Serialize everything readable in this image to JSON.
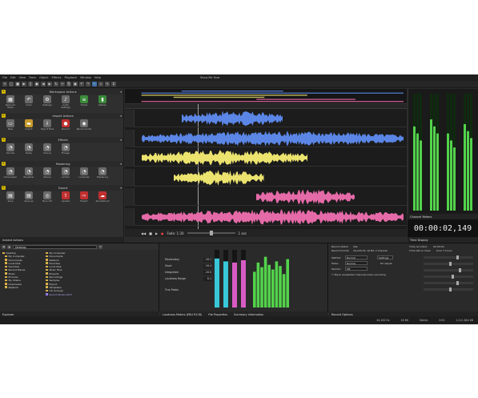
{
  "menubar": {
    "items": [
      "File",
      "Edit",
      "View",
      "Track",
      "Object",
      "Effects",
      "Playback",
      "Window",
      "Help"
    ],
    "help_label": "Show Me How"
  },
  "colors": {
    "accent_yellow": "#d4b800",
    "track_blue": "#5b86e6",
    "track_yellow": "#ece36f",
    "track_pink": "#e56aa8",
    "meter_green": "#53d34b",
    "meter_cyan": "#38c8d8",
    "meter_magenta": "#d85cc4"
  },
  "left_panel": {
    "sections": [
      {
        "num": "1",
        "title": "Workspace Actions",
        "buttons": [
          {
            "label": "Reduced Mode",
            "icon": "layout-icon",
            "color": "#6a6a6a"
          },
          {
            "label": "Undo",
            "icon": "undo-icon",
            "color": "#6a6a6a"
          },
          {
            "label": "Settings",
            "icon": "gear-icon",
            "color": "#6a6a6a"
          },
          {
            "label": "Audio Settings",
            "icon": "speaker-icon",
            "color": "#6a6a6a"
          },
          {
            "label": "Tracks",
            "icon": "tracks-icon",
            "color": "#3a8a3a"
          },
          {
            "label": "Marker",
            "icon": "marker-icon",
            "color": "#3a8a3a"
          }
        ]
      },
      {
        "num": "2",
        "title": "Import Actions",
        "buttons": [
          {
            "label": "New",
            "icon": "new-file-icon",
            "color": "#6a6a6a"
          },
          {
            "label": "Import",
            "icon": "folder-icon",
            "color": "#c99a2a"
          },
          {
            "label": "Import Files",
            "icon": "import-icon",
            "color": "#6a6a6a"
          },
          {
            "label": "Record",
            "icon": "record-icon",
            "color": "#c03030"
          },
          {
            "label": "Record Audio",
            "icon": "mic-icon",
            "color": "#6a6a6a"
          }
        ]
      },
      {
        "num": "3",
        "title": "Effects",
        "buttons": [
          {
            "label": "Volume",
            "icon": "dial-icon",
            "color": "#6a6a6a"
          },
          {
            "label": "Delay",
            "icon": "dial-icon",
            "color": "#6a6a6a"
          },
          {
            "label": "Chorus",
            "icon": "dial-icon",
            "color": "#6a6a6a"
          },
          {
            "label": "Flanger",
            "icon": "dial-icon",
            "color": "#6a6a6a"
          }
        ]
      },
      {
        "num": "4",
        "title": "Mastering",
        "buttons": [
          {
            "label": "Compressor",
            "icon": "dial-icon",
            "color": "#6a6a6a"
          },
          {
            "label": "Equalizer",
            "icon": "dial-icon",
            "color": "#6a6a6a"
          },
          {
            "label": "Stereo",
            "icon": "dial-icon",
            "color": "#6a6a6a"
          },
          {
            "label": "Limiter",
            "icon": "dial-icon",
            "color": "#6a6a6a"
          },
          {
            "label": "Loudness",
            "icon": "dial-icon",
            "color": "#6a6a6a"
          },
          {
            "label": "Mastering",
            "icon": "dial-icon",
            "color": "#6a6a6a"
          }
        ]
      },
      {
        "num": "5",
        "title": "Export",
        "buttons": [
          {
            "label": "Save",
            "icon": "save-icon",
            "color": "#6a6a6a"
          },
          {
            "label": "Save as",
            "icon": "save-as-icon",
            "color": "#6a6a6a"
          },
          {
            "label": "Burn CD",
            "icon": "cd-icon",
            "color": "#6a6a6a"
          },
          {
            "label": "Upload",
            "icon": "upload-icon",
            "color": "#c03030"
          },
          {
            "label": "Export",
            "icon": "export-icon",
            "color": "#c03030"
          },
          {
            "label": "SoundCloud",
            "icon": "cloud-icon",
            "color": "#c03030"
          }
        ]
      }
    ],
    "footer": "Instant Actions"
  },
  "tracks": {
    "lanes": [
      {
        "color": "#5b86e6",
        "start": 0.17,
        "end": 0.55
      },
      {
        "color": "#5b86e6",
        "start": 0.02,
        "end": 1.0
      },
      {
        "color": "#ece36f",
        "start": 0.02,
        "end": 0.64
      },
      {
        "color": "#ece36f",
        "start": 0.14,
        "end": 0.48
      },
      {
        "color": "#e56aa8",
        "start": 0.45,
        "end": 0.82
      },
      {
        "color": "#e56aa8",
        "start": 0.02,
        "end": 1.0
      }
    ],
    "playhead": 0.23,
    "transport_zoom": "Fade: 1:30",
    "transport_label": "1 sec"
  },
  "right_panel": {
    "channel_label": "Channel Meters",
    "time_value": "00:00:02,149",
    "time_label": "Time Display"
  },
  "explorer": {
    "path": "Desktop",
    "tree": [
      "Desktop",
      "My Computer",
      "Documents",
      "Local Disk",
      "Favorites",
      "Recent Places",
      "Music",
      "Pictures",
      "My Videos",
      "Downloads",
      "Network"
    ],
    "files": [
      {
        "name": "My Computer",
        "selected": false
      },
      {
        "name": "Documents",
        "selected": false
      },
      {
        "name": "Network",
        "selected": false
      },
      {
        "name": "Favorites",
        "selected": false
      },
      {
        "name": "Local Disk",
        "selected": false
      },
      {
        "name": "Music Files",
        "selected": false
      },
      {
        "name": "Projects",
        "selected": false
      },
      {
        "name": "Recordings",
        "selected": false
      },
      {
        "name": "Samples",
        "selected": false
      },
      {
        "name": "Export",
        "selected": false
      },
      {
        "name": "Templates",
        "selected": false
      },
      {
        "name": "CD Arrange",
        "selected": false
      },
      {
        "name": "Sound Studio 2017",
        "selected": true
      }
    ],
    "footer": "Explorer"
  },
  "loudness": {
    "rows": [
      {
        "label": "Momentary",
        "value": "-18.1"
      },
      {
        "label": "Short",
        "value": "-16.4"
      },
      {
        "label": "Integrated",
        "value": "-16.0"
      },
      {
        "label": "Loudness Range",
        "value": "6.1"
      }
    ],
    "true_peaks_label": "True Peaks",
    "tabs": [
      "Loudness Meters (EBU R128)",
      "File Properties",
      "Summary Information"
    ],
    "meter_levels": [
      0.85,
      0.8,
      0.78,
      0.82
    ],
    "spectrum_levels": [
      0.62,
      0.78,
      0.7,
      0.88,
      0.74,
      0.66,
      0.8,
      0.72,
      0.58,
      0.84
    ]
  },
  "record": {
    "status_label": "Record status:",
    "status_value": "Idle",
    "format_label": "Record format:",
    "format_value": "44,100 Hz, 16 Bit, 2 Channel",
    "time_rec_label": "Time recorded:",
    "time_rec_value": "00:00:00",
    "time_left_label": "Time left on drive:",
    "time_left_value": "Over 3 hours",
    "method_label": "Method:",
    "method_value": "Normal",
    "mode_label": "Mode:",
    "mode_value": "Normal",
    "monitor_label": "Monitor:",
    "monitor_value": "Off",
    "settings_label": "Settings",
    "dc_label": "DC Adjust",
    "checkbox_label": "Place unselected channels when recording",
    "footer": "Record Options",
    "slider_values": [
      0.7,
      0.55,
      0.75,
      0.6,
      0.7,
      0.55
    ]
  },
  "statusbar": {
    "items": [
      "44,100 Hz",
      "16 Bit",
      "Stereo",
      "0:02",
      "2,211,844 KB"
    ]
  }
}
